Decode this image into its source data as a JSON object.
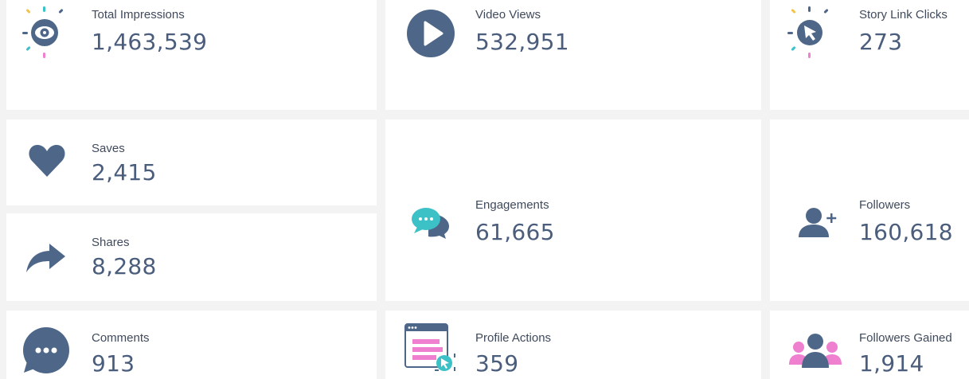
{
  "colors": {
    "icon_primary": "#4e6789",
    "accent_teal": "#3cc1c7",
    "accent_pink": "#ef7fcf",
    "accent_yellow": "#f3c34a",
    "label_text": "#3f4a5c",
    "value_text": "#4a5d7c",
    "background": "#f3f3f3",
    "card": "#ffffff"
  },
  "metrics": {
    "total_impressions": {
      "label": "Total Impressions",
      "value": "1,463,539",
      "icon": "eye-icon"
    },
    "video_views": {
      "label": "Video Views",
      "value": "532,951",
      "icon": "play-icon"
    },
    "story_link_clicks": {
      "label": "Story Link Clicks",
      "value": "273",
      "icon": "cursor-click-icon"
    },
    "saves": {
      "label": "Saves",
      "value": "2,415",
      "icon": "heart-icon"
    },
    "shares": {
      "label": "Shares",
      "value": "8,288",
      "icon": "share-arrow-icon"
    },
    "engagements": {
      "label": "Engagements",
      "value": "61,665",
      "icon": "chat-bubbles-icon"
    },
    "followers": {
      "label": "Followers",
      "value": "160,618",
      "icon": "add-user-icon"
    },
    "comments": {
      "label": "Comments",
      "value": "913",
      "icon": "comment-icon"
    },
    "profile_actions": {
      "label": "Profile Actions",
      "value": "359",
      "icon": "browser-click-icon"
    },
    "followers_gained": {
      "label": "Followers Gained",
      "value": "1,914",
      "icon": "user-group-icon"
    }
  }
}
